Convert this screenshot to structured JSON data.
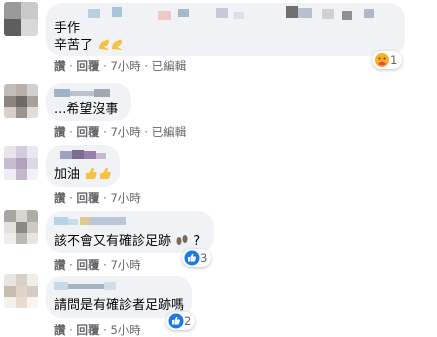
{
  "comments": [
    {
      "text_line1": "手作",
      "text_line2": "辛苦了",
      "meta": {
        "like": "讚",
        "reply": "回覆",
        "time": "7小時",
        "edited": "已編輯"
      },
      "reaction_count": "1",
      "reaction_icon": "care-icon"
    },
    {
      "text": "...希望沒事",
      "meta": {
        "like": "讚",
        "reply": "回覆",
        "time": "7小時",
        "edited": "已編輯"
      }
    },
    {
      "text": "加油",
      "meta": {
        "like": "讚",
        "reply": "回覆",
        "time": "7小時"
      }
    },
    {
      "text": "該不會又有確診足跡",
      "text_suffix": "?",
      "meta": {
        "like": "讚",
        "reply": "回覆",
        "time": "7小時"
      },
      "reaction_count": "3",
      "reaction_icon": "like-icon"
    },
    {
      "text": "請問是有確診者足跡嗎",
      "meta": {
        "like": "讚",
        "reply": "回覆",
        "time": "5小時"
      },
      "reaction_count": "2",
      "reaction_icon": "like-icon"
    }
  ],
  "separator": "·",
  "colors": {
    "bubble": "#f0f2f5",
    "meta_text": "#65676b",
    "like_blue": "#1877f2",
    "body_text": "#050505"
  }
}
